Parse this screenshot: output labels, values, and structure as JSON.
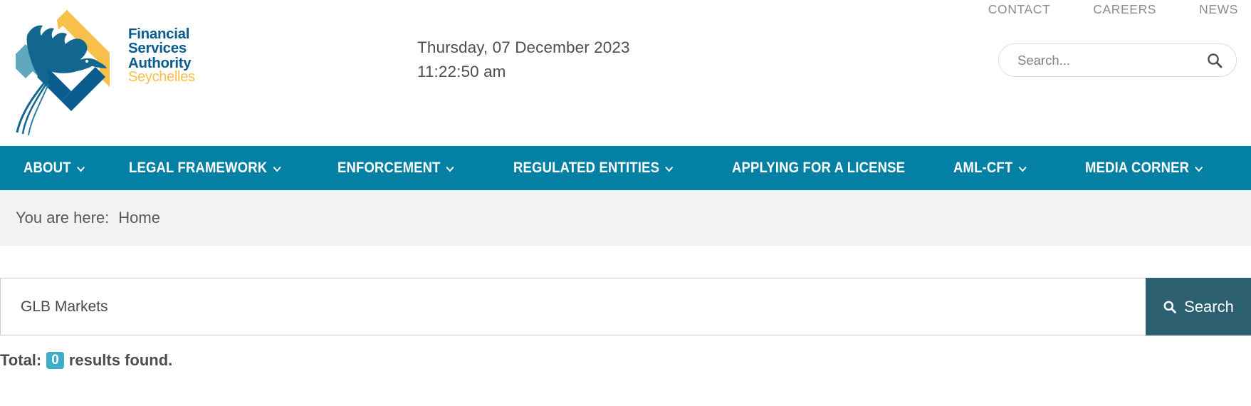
{
  "brand": {
    "logo_icon": "flying-bird-diamond-logo",
    "line1": "Financial",
    "line2": "Services",
    "line3": "Authority",
    "line4": "Seychelles",
    "primary_color": "#0a5c8f",
    "accent_color": "#f7c04a"
  },
  "header": {
    "date": "Thursday, 07 December 2023",
    "time": "11:22:50 am",
    "utility_links": [
      {
        "label": "CONTACT"
      },
      {
        "label": "CAREERS"
      },
      {
        "label": "NEWS"
      }
    ],
    "search": {
      "placeholder": "Search...",
      "value": "",
      "icon": "search-icon"
    }
  },
  "mainnav": {
    "background_color": "#0480a4",
    "items": [
      {
        "label": "ABOUT",
        "has_dropdown": true
      },
      {
        "label": "LEGAL FRAMEWORK",
        "has_dropdown": true
      },
      {
        "label": "ENFORCEMENT",
        "has_dropdown": true
      },
      {
        "label": "REGULATED ENTITIES",
        "has_dropdown": true
      },
      {
        "label": "APPLYING FOR A LICENSE",
        "has_dropdown": false
      },
      {
        "label": "AML-CFT",
        "has_dropdown": true
      },
      {
        "label": "MEDIA CORNER",
        "has_dropdown": true
      }
    ]
  },
  "breadcrumb": {
    "label": "You are here:",
    "current": "Home"
  },
  "main": {
    "search_form": {
      "query_value": "GLB Markets",
      "query_placeholder": "",
      "button_label": "Search",
      "button_icon": "search-icon",
      "button_color": "#2c5f70"
    },
    "results": {
      "prefix": "Total:",
      "count": "0",
      "suffix": "results found.",
      "badge_color": "#3daec6"
    }
  }
}
